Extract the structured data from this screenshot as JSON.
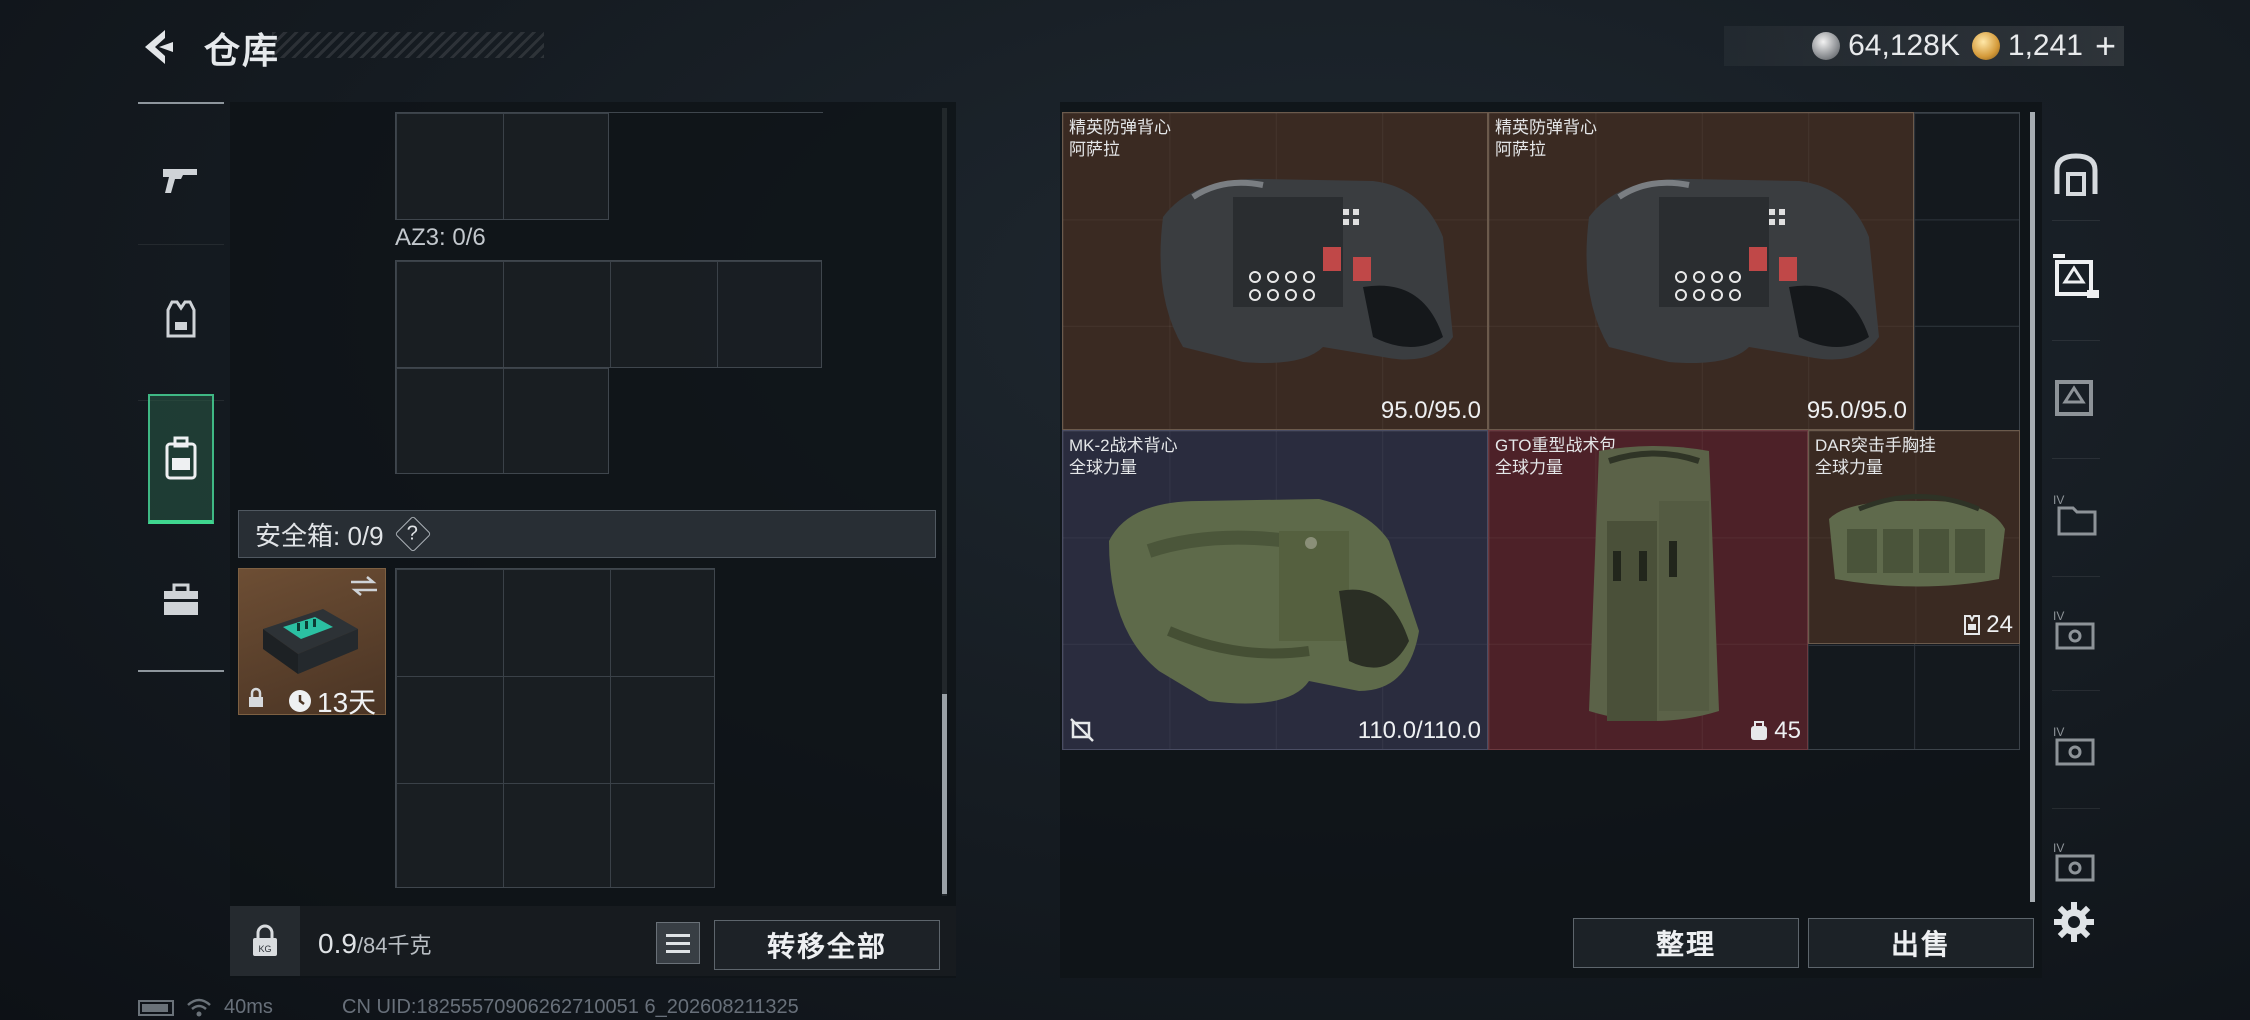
{
  "header": {
    "title": "仓库",
    "currency_silver": "64,128K",
    "currency_gold": "1,241",
    "plus_label": "+"
  },
  "left": {
    "az3_label": "AZ3: 0/6",
    "safe_box_label": "安全箱: 0/9",
    "safe_help_label": "?",
    "safe_case_time": "13天",
    "weight_value": "0.9",
    "weight_unit": "/84千克",
    "transfer_all_label": "转移全部"
  },
  "items": [
    {
      "name": "精英防弹背心",
      "sub": "阿萨拉",
      "value": "95.0/95.0",
      "color": "#3a2a22"
    },
    {
      "name": "精英防弹背心",
      "sub": "阿萨拉",
      "value": "95.0/95.0",
      "color": "#3a2a22"
    },
    {
      "name": "MK-2战术背心",
      "sub": "全球力量",
      "value": "110.0/110.0",
      "color": "#2a2c3e"
    },
    {
      "name": "GTO重型战术包",
      "sub": "全球力量",
      "value": "45",
      "color": "#4d2128"
    },
    {
      "name": "DAR突击手胸挂",
      "sub": "全球力量",
      "value": "24",
      "color": "#3a2a22"
    }
  ],
  "right": {
    "sort_label": "整理",
    "sell_label": "出售"
  },
  "status": {
    "ping": "40ms",
    "uid": "CN UID:18255570906262710051 6_202608211325"
  }
}
